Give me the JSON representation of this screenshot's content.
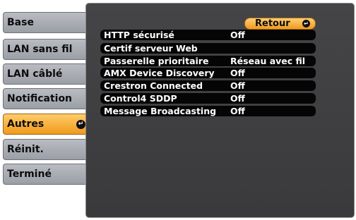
{
  "tabs": [
    {
      "label": "Base"
    },
    {
      "label": "LAN sans fil"
    },
    {
      "label": "LAN câblé"
    },
    {
      "label": "Notification"
    },
    {
      "label": "Autres",
      "active": true
    },
    {
      "label": "Réinit."
    },
    {
      "label": "Terminé"
    }
  ],
  "panel": {
    "return_label": "Retour",
    "items": [
      {
        "label": "HTTP sécurisé",
        "value": "Off"
      },
      {
        "label": "Certif serveur Web",
        "value": ""
      },
      {
        "label": "Passerelle prioritaire",
        "value": "Réseau avec fil"
      },
      {
        "label": "AMX Device Discovery",
        "value": "Off"
      },
      {
        "label": "Crestron Connected",
        "value": "Off"
      },
      {
        "label": "Control4 SDDP",
        "value": "Off"
      },
      {
        "label": "Message Broadcasting",
        "value": "Off"
      }
    ]
  },
  "icons": {
    "enter": "enter-icon"
  },
  "colors": {
    "accent": "#f5a83a",
    "panel": "#3e3e40",
    "item": "#050505",
    "tab": "#a9acb2"
  }
}
